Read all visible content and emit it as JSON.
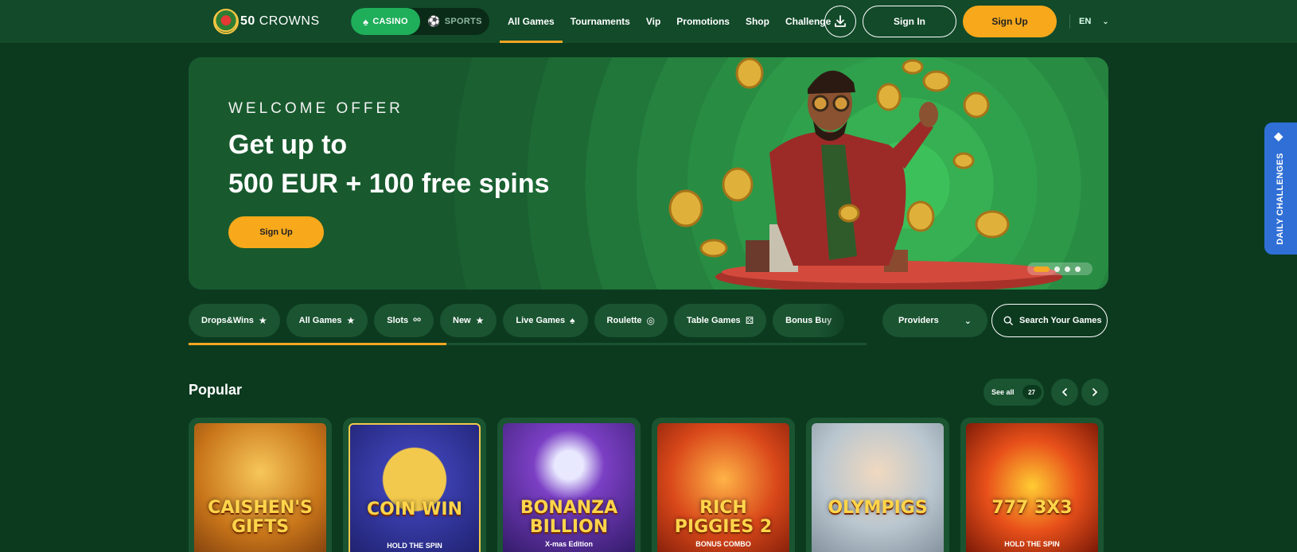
{
  "header": {
    "logo_text_num": "50",
    "logo_text_name": "CROWNS",
    "mode": {
      "casino": "CASINO",
      "sports": "SPORTS"
    },
    "nav": [
      "All Games",
      "Tournaments",
      "Vip",
      "Promotions",
      "Shop",
      "Challenge"
    ],
    "signin_label": "Sign In",
    "signup_label": "Sign Up",
    "lang": "EN"
  },
  "hero": {
    "kicker": "WELCOME OFFER",
    "title_line1": "Get up to",
    "title_line2": "500 EUR + 100 free spins",
    "cta": "Sign Up"
  },
  "daily_challenges": "DAILY CHALLENGES",
  "categories": [
    {
      "label": "Drops&Wins",
      "icon": "star-icon"
    },
    {
      "label": "All Games",
      "icon": "star-icon"
    },
    {
      "label": "Slots",
      "icon": "cherry-icon"
    },
    {
      "label": "New",
      "icon": "star-icon"
    },
    {
      "label": "Live Games",
      "icon": "spade-icon"
    },
    {
      "label": "Roulette",
      "icon": "roulette-icon"
    },
    {
      "label": "Table Games",
      "icon": "dice-icon"
    },
    {
      "label": "Bonus Buy",
      "icon": "cart-icon"
    }
  ],
  "providers_label": "Providers",
  "search_placeholder": "Search Your Games",
  "popular": {
    "title": "Popular",
    "see_all": "See all",
    "count": "27"
  },
  "games": [
    {
      "name": "CAISHEN'S GIFTS",
      "sub": "",
      "bg": "#c9761a"
    },
    {
      "name": "COIN WIN",
      "sub": "HOLD THE SPIN",
      "bg": "#2a2f8e"
    },
    {
      "name": "BONANZA BILLION",
      "sub": "X-mas Edition",
      "bg": "#4b2a8a"
    },
    {
      "name": "RICH PIGGIES 2",
      "sub": "BONUS COMBO",
      "bg": "#c0421a"
    },
    {
      "name": "OLYMPIGS",
      "sub": "",
      "bg": "#b9c6cf"
    },
    {
      "name": "777 3X3",
      "sub": "HOLD THE SPIN",
      "bg": "#c93b12"
    }
  ],
  "colors": {
    "background": "#0c3a1f",
    "header": "#124a2a",
    "accent": "#f7a81b",
    "chip": "#1a5431",
    "casino_active": "#1fae5a",
    "daily_tab": "#2f6fd6"
  }
}
